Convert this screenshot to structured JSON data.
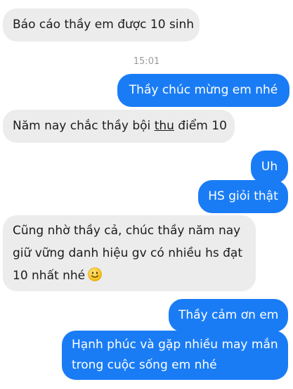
{
  "messages": [
    {
      "id": "m1",
      "dir": "in",
      "text": "Báo cáo thầy em được 10 sinh"
    },
    {
      "id": "m3",
      "dir": "out",
      "text": "Thầy chúc mừng em nhé"
    },
    {
      "id": "m4",
      "dir": "in",
      "pre": "Năm nay chắc thầy bội ",
      "underlined": "thu",
      "post": " điểm 10"
    },
    {
      "id": "m5",
      "dir": "out",
      "text": "Uh"
    },
    {
      "id": "m6",
      "dir": "out",
      "text": "HS giỏi thật"
    },
    {
      "id": "m7",
      "dir": "in",
      "lines": [
        "Cũng nhờ thầy cả, chúc thầy năm nay",
        "giữ vững danh hiệu gv có nhiều hs đạt",
        "10 nhất nhé"
      ],
      "emoji": "slightly-smiling-face"
    },
    {
      "id": "m8",
      "dir": "out",
      "text": "Thầy cảm ơn em"
    },
    {
      "id": "m9",
      "dir": "out",
      "lines": [
        "Hạnh phúc và gặp nhiều may mắn",
        "trong cuộc sống em nhé"
      ]
    }
  ],
  "timestamp": "15:01",
  "colors": {
    "incoming_bubble": "#ececec",
    "outgoing_bubble": "#1a7cf5",
    "timestamp_text": "#9a9a9a"
  }
}
